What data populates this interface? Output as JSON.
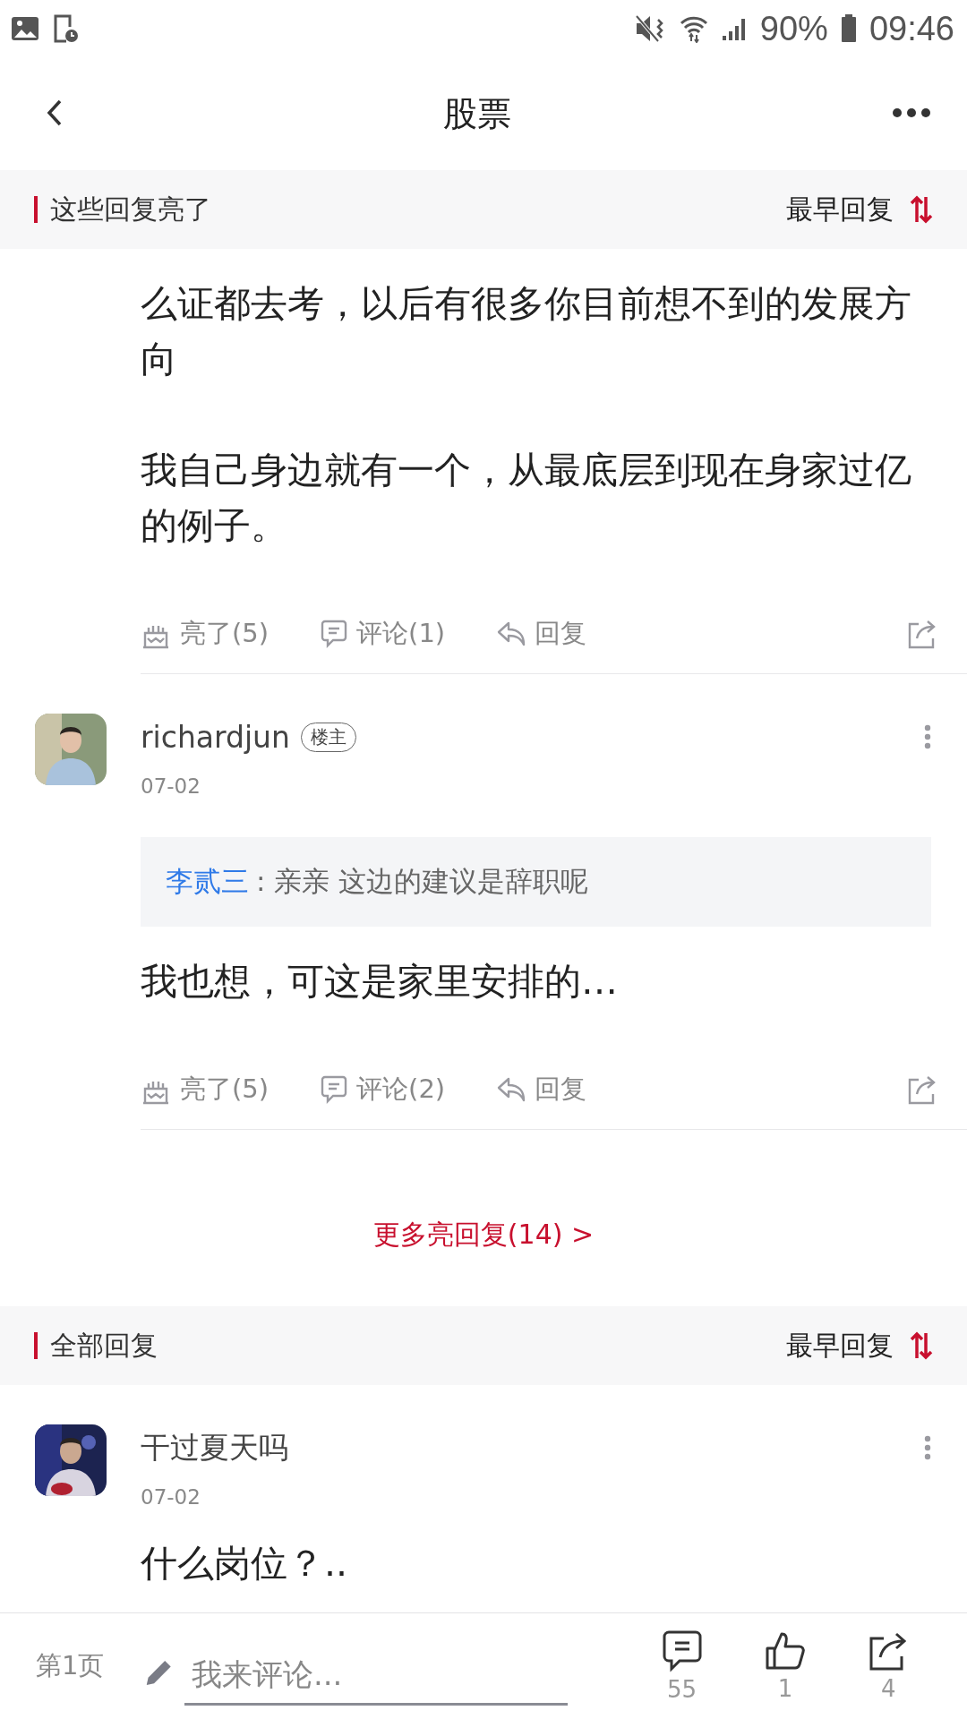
{
  "status_bar": {
    "battery": "90%",
    "time": "09:46"
  },
  "nav": {
    "title": "股票"
  },
  "highlight_section": {
    "title": "这些回复亮了",
    "sort": "最早回复"
  },
  "highlight_replies": [
    {
      "kind": "continuation",
      "paragraphs": [
        "么证都去考，以后有很多你目前想不到的发展方向",
        "我自己身边就有一个，从最底层到现在身家过亿的例子。"
      ],
      "actions": {
        "light": "亮了(5)",
        "comment": "评论(1)",
        "reply": "回复"
      }
    },
    {
      "kind": "post",
      "author": "richardjun",
      "badge": "楼主",
      "date": "07-02",
      "quote": {
        "author": "李贰三",
        "text": ": 亲亲 这边的建议是辞职呢"
      },
      "paragraphs": [
        "我也想，可这是家里安排的…"
      ],
      "actions": {
        "light": "亮了(5)",
        "comment": "评论(2)",
        "reply": "回复"
      }
    }
  ],
  "more_link": "更多亮回复(14) >",
  "all_section": {
    "title": "全部回复",
    "sort": "最早回复"
  },
  "all_replies": [
    {
      "kind": "post",
      "author": "干过夏天吗",
      "date": "07-02",
      "paragraphs": [
        "什么岗位？.."
      ]
    }
  ],
  "bottom_bar": {
    "page": "第1页",
    "placeholder": "我来评论...",
    "comments": "55",
    "likes": "1",
    "shares": "4"
  }
}
